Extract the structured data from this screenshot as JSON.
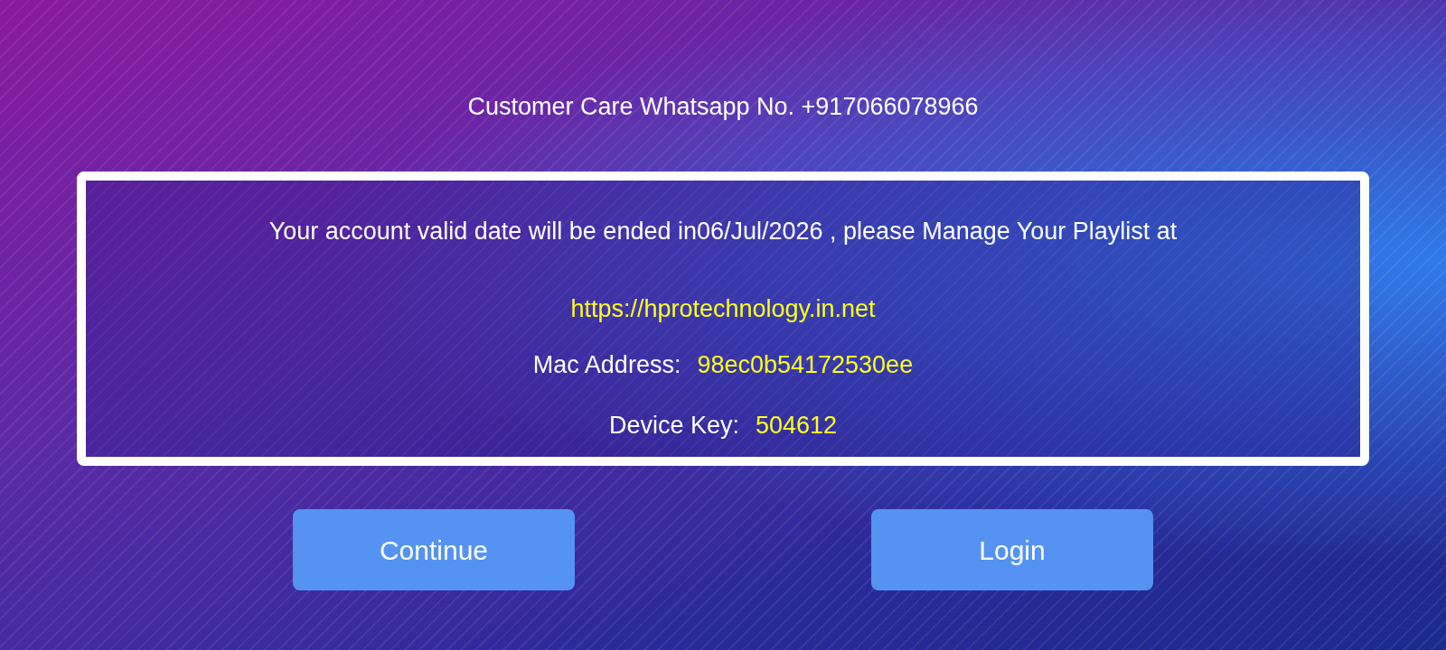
{
  "header": {
    "text": "Customer Care Whatsapp No. +917066078966"
  },
  "notice": {
    "message": "Your account valid date will be ended in06/Jul/2026 , please Manage Your Playlist at",
    "url": "https://hprotechnology.in.net",
    "fields": [
      {
        "label": "Mac Address:",
        "value": "98ec0b54172530ee"
      },
      {
        "label": "Device Key:",
        "value": "504612"
      }
    ]
  },
  "buttons": [
    {
      "label": "Continue"
    },
    {
      "label": "Login"
    }
  ]
}
